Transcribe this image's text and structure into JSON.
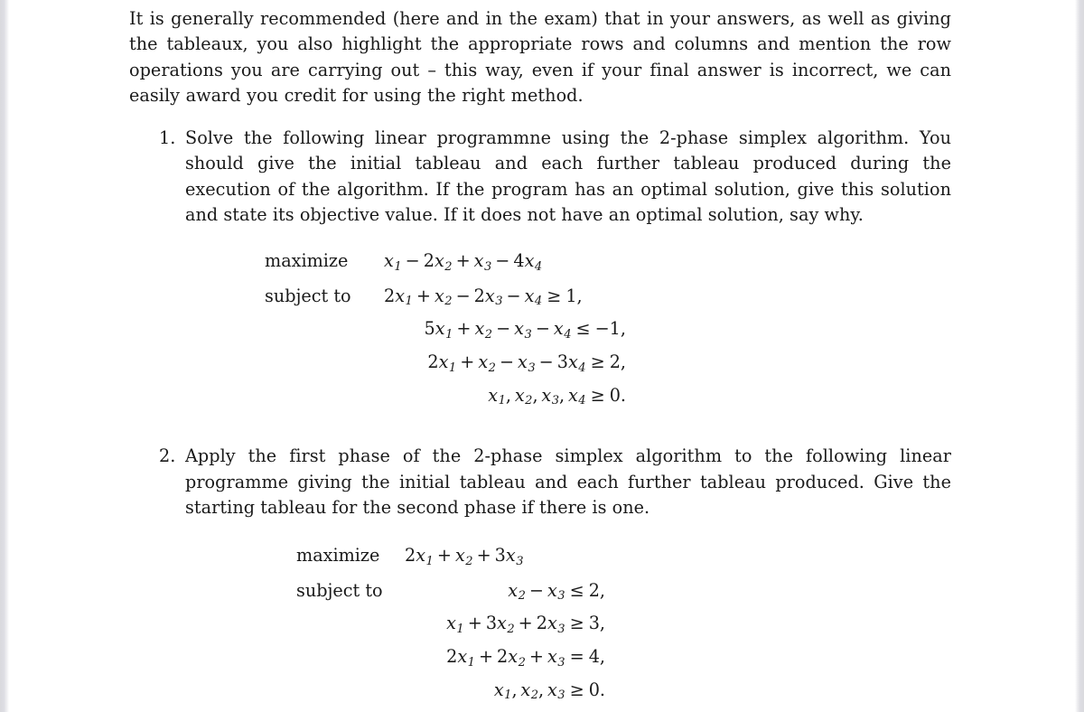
{
  "document": {
    "intro_paragraph": "It is generally recommended (here and in the exam) that in your answers, as well as giving the tableaux, you also highlight the appropriate rows and columns and mention the row operations you are carrying out – this way, even if your final answer is incorrect, we can easily award you credit for using the right method.",
    "problems": [
      {
        "marker": "1.",
        "text": "Solve the following linear programmne using the 2-phase simplex algorithm. You should give the initial tableau and each further tableau produced during the execution of the algorithm. If the program has an optimal solution, give this solution and state its objective value. If it does not have an optimal solution, say why.",
        "maximize_label": "maximize",
        "objective": "x₁ − 2x₂ + x₃ − 4x₄",
        "subject_to_label": "subject to",
        "constraints": [
          "2x₁ + x₂ − 2x₃ − x₄ ≥ 1,",
          "5x₁ + x₂ − x₃ − x₄ ≤ −1,",
          "2x₁ + x₂ − x₃ − 3x₄ ≥ 2,",
          "x₁, x₂, x₃, x₄ ≥ 0."
        ]
      },
      {
        "marker": "2.",
        "text": "Apply the first phase of the 2-phase simplex algorithm to the following linear programme giving the initial tableau and each further tableau produced. Give the starting tableau for the second phase if there is one.",
        "maximize_label": "maximize",
        "objective": "2x₁ + x₂ + 3x₃",
        "subject_to_label": "subject to",
        "constraints": [
          "x₂ − x₃ ≤ 2,",
          "x₁ + 3x₂ + 2x₃ ≥ 3,",
          "2x₁ + 2x₂ + x₃ = 4,",
          "x₁, x₂, x₃ ≥ 0."
        ]
      }
    ]
  }
}
